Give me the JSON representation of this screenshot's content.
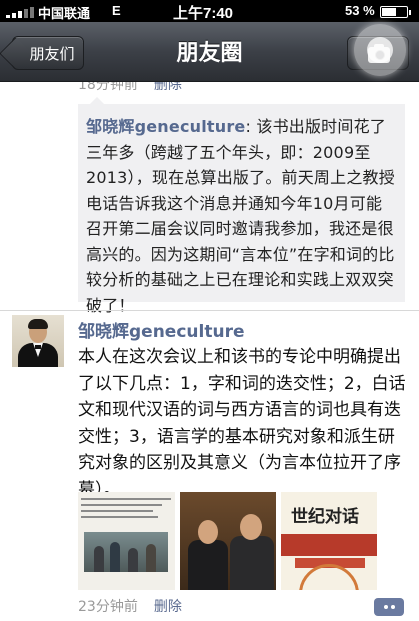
{
  "status_bar": {
    "carrier": "中国联通",
    "network": "E",
    "time": "上午7:40",
    "battery_percent": "53 %",
    "battery_level": 0.53
  },
  "nav": {
    "back_label": "朋友们",
    "title": "朋友圈",
    "camera_icon": "camera-icon"
  },
  "previous_post": {
    "timestamp": "18分钟前",
    "delete_label": "删除",
    "comment": {
      "author": "邹晓辉geneculture",
      "text": ": 该书出版时间花了三年多（跨越了五个年头，即：2009至2013），现在总算出版了。前天周上之教授电话告诉我这个消息并通知今年10月可能召开第二届会议同时邀请我参加，我还是很高兴的。因为这期间“言本位”在字和词的比较分析的基础之上已在理论和实践上双双突破了！"
    }
  },
  "post": {
    "author": "邹晓辉geneculture",
    "text": "本人在这次会议上和该书的专论中明确提出了以下几点：1，字和词的迭交性；2，白话文和现代汉语的词与西方语言的词也具有迭交性；3，语言学的基本研究对象和派生研究对象的区别及其意义（为言本位拉开了序幕）。",
    "photos": [
      "photo-1",
      "photo-2",
      "photo-3"
    ],
    "photo3_title": "世纪对话",
    "timestamp": "23分钟前",
    "delete_label": "删除",
    "comment_icon": "comment-icon"
  }
}
